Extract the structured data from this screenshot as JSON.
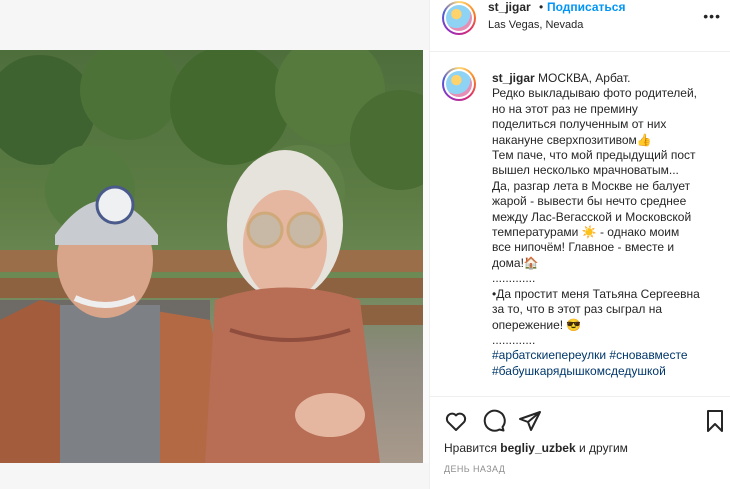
{
  "post": {
    "username": "st_jigar",
    "separator": "•",
    "follow_label": "Подписаться",
    "location": "Las Vegas, Nevada",
    "more_icon": "more-horizontal-icon",
    "photo_alt": "photo"
  },
  "caption": {
    "username": "st_jigar",
    "lines": [
      " МОСКВА, Арбат.",
      "Редко выкладываю фото родителей,",
      "но на этот раз не премину",
      "поделиться полученным от них",
      "накануне сверхпозитивом👍",
      "Тем паче, что мой предыдущий пост",
      "вышел несколько мрачноватым...",
      "Да, разгар лета в Москве не балует",
      "жарой - вывести бы нечто среднее",
      "между Лас-Вегасской и Московской",
      "температурами ☀️ - однако моим",
      "все нипочём! Главное - вместе и",
      "дома!🏠",
      ".............",
      "•Да простит меня Татьяна Сергеевна",
      "за то, что в этот раз сыграл на",
      "опережение! 😎",
      ".............",
      "#арбатскиепереулки #сновавместе",
      "#бабушкарядышкомсдедушкой"
    ]
  },
  "actions": {
    "like_icon": "heart-icon",
    "comment_icon": "comment-icon",
    "share_icon": "share-icon",
    "save_icon": "bookmark-icon"
  },
  "likes": {
    "prefix": "Нравится ",
    "user": "begliy_uzbek",
    "suffix": " и другим"
  },
  "timestamp": "ДЕНЬ НАЗАД",
  "colors": {
    "accent": "#0095f6",
    "hashtag": "#00376b",
    "muted": "#8e8e8e"
  }
}
